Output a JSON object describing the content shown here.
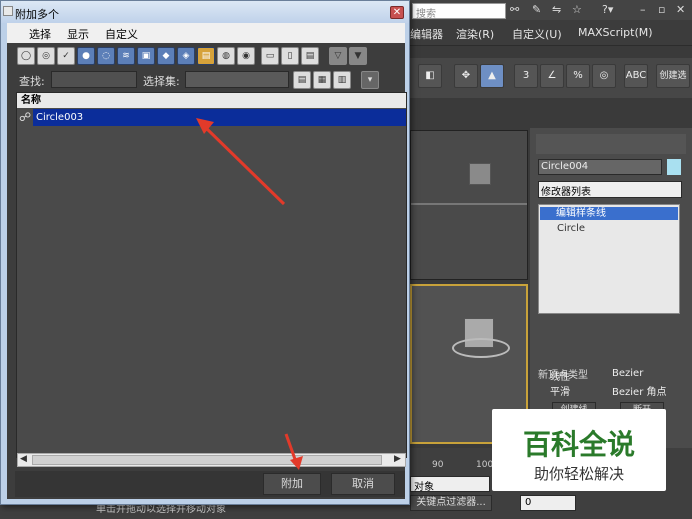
{
  "background": {
    "search_placeholder": "搜索",
    "menu": [
      "编辑器",
      "渲染(R)",
      "自定义(U)",
      "MAXScript(M)"
    ],
    "object_name": "Circle004",
    "modifier_list": "修改器列表",
    "modifier_stack": [
      "编辑样条线",
      "Circle"
    ],
    "new_vertex_type_title": "新顶点类型",
    "vertex_types": [
      "线性",
      "Bezier",
      "平滑",
      "Bezier 角点"
    ],
    "create_button": "创建线",
    "break_button": "断开",
    "ruler_values": [
      "90",
      "100"
    ],
    "key_filter": "关键点过滤器...",
    "frame_value": "0",
    "object_dropdown": "对象",
    "status_text": "单击并拖动以选择并移动对象",
    "create_select_label": "创建选"
  },
  "dialog": {
    "title": "附加多个",
    "menu": [
      "选择",
      "显示",
      "自定义"
    ],
    "find_label": "查找:",
    "selection_set_label": "选择集:",
    "list_header": "名称",
    "rows": [
      "Circle003"
    ],
    "attach_button": "附加",
    "cancel_button": "取消"
  },
  "watermark": {
    "big": "百科全说",
    "small": "助你轻松解决"
  },
  "colors": {
    "selection": "#0b2d9a",
    "viewport_active_border": "#c8a23a",
    "arrow": "#e23a2a"
  }
}
